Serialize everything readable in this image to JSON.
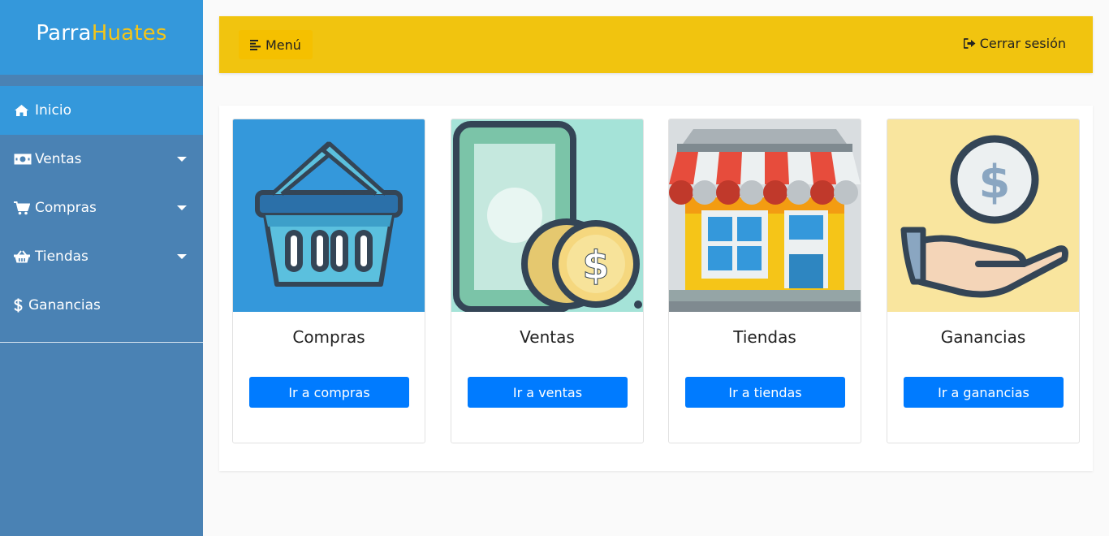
{
  "brand": {
    "part1": "Parra",
    "part2": "Huates"
  },
  "sidebar": {
    "items": [
      {
        "label": "Inicio",
        "icon": "home-icon"
      },
      {
        "label": "Ventas",
        "icon": "money-bill-icon"
      },
      {
        "label": "Compras",
        "icon": "shopping-cart-icon"
      },
      {
        "label": "Tiendas",
        "icon": "basket-icon"
      },
      {
        "label": "Ganancias",
        "icon": "dollar-icon"
      }
    ]
  },
  "topbar": {
    "menu_label": "Menú",
    "logout_label": "Cerrar sesión"
  },
  "cards": [
    {
      "title": "Compras",
      "button": "Ir a compras",
      "image": "basket-illustration"
    },
    {
      "title": "Ventas",
      "button": "Ir a ventas",
      "image": "phone-coins-illustration"
    },
    {
      "title": "Tiendas",
      "button": "Ir a tiendas",
      "image": "store-illustration"
    },
    {
      "title": "Ganancias",
      "button": "Ir a ganancias",
      "image": "hand-coin-illustration"
    }
  ],
  "colors": {
    "sidebar": "#4a82b4",
    "sidebar_active": "#3498db",
    "topbar": "#f1c40f",
    "brand_accent": "#f5c518",
    "button": "#007bff"
  }
}
